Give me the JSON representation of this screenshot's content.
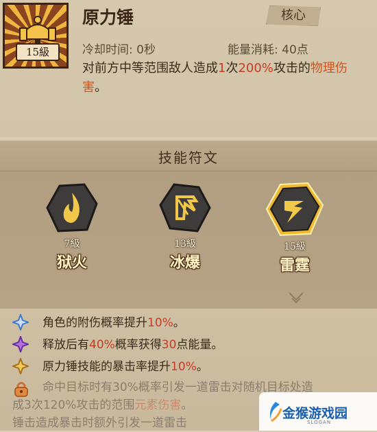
{
  "skill": {
    "name": "原力锤",
    "level": "15級",
    "badge": "核心",
    "cooldown": "冷却时间: 0秒",
    "energy": "能量消耗: 40点",
    "desc_part1": "对前方中等范围敌人造成",
    "desc_num": "1",
    "desc_part2": "次",
    "desc_pct": "200%",
    "desc_part3": "攻击的",
    "desc_dmg": "物理伤害",
    "desc_end": "。"
  },
  "runes": {
    "title": "技能符文",
    "items": [
      {
        "level": "7級",
        "name": "狱火",
        "icon": "flame-icon",
        "selected": false
      },
      {
        "level": "13級",
        "name": "冰爆",
        "icon": "ice-burst-icon",
        "selected": false
      },
      {
        "level": "15級",
        "name": "雷霆",
        "icon": "thunder-icon",
        "selected": true
      }
    ]
  },
  "effects": [
    {
      "icon": "blue-star-icon",
      "color": "#3d7ad0",
      "pre": "角色的附伤概率提升",
      "val": "10%",
      "post": "。"
    },
    {
      "icon": "purple-star-icon",
      "color": "#8a3cc8",
      "pre": "释放后有",
      "val": "40%",
      "mid": "概率获得",
      "val2": "30",
      "post": "点能量。"
    },
    {
      "icon": "gold-star-icon",
      "color": "#d9a030",
      "pre": "原力锤技能的暴击率提升",
      "val": "10%",
      "post": "。"
    },
    {
      "icon": "lock-icon",
      "color": "#d07030",
      "line1": "命中目标时有30%概率引发一道雷击对随机目标处造",
      "line2_pre": "成3次120%攻击的范围",
      "line2_hl": "元素伤害",
      "line2_post": "。",
      "line3": "锤击造成暴击时额外引发一道雷击"
    }
  ],
  "watermark": {
    "text": "金猴游戏园",
    "sub": "SLOGAN"
  }
}
